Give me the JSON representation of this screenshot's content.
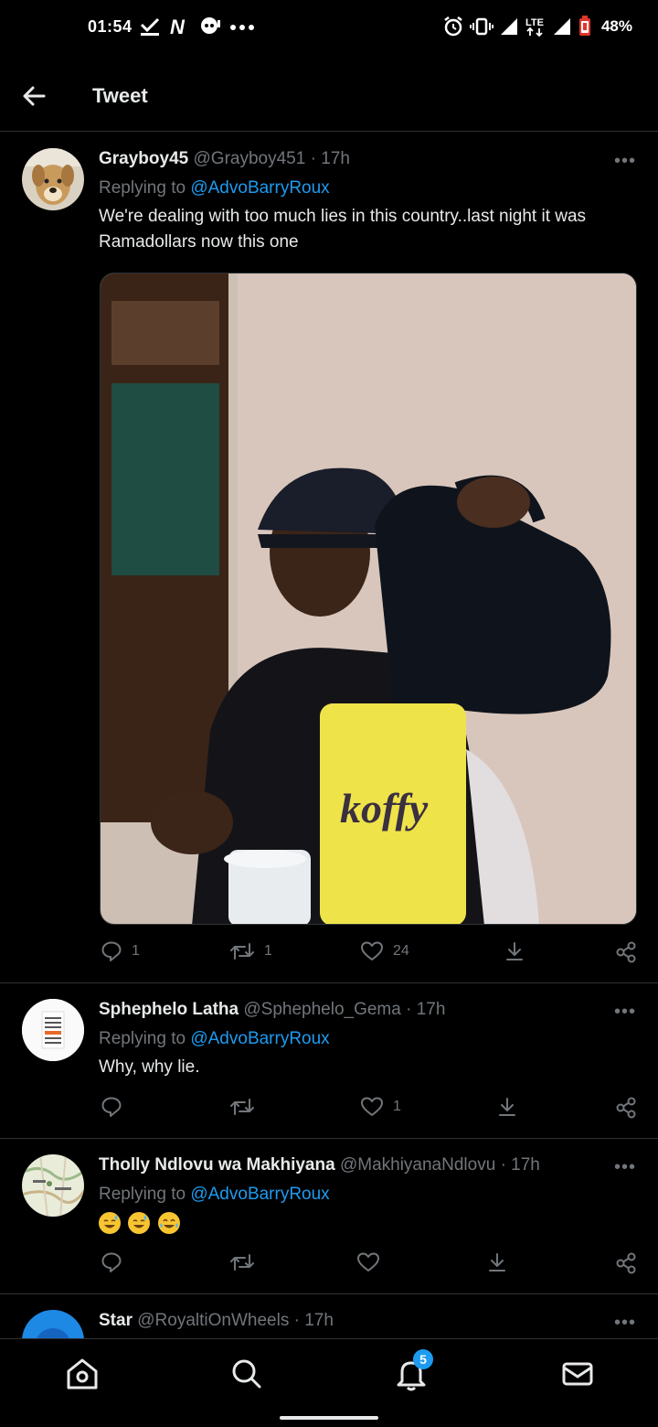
{
  "status_bar": {
    "time": "01:54",
    "battery": "48%",
    "network": "LTE",
    "icons": [
      "check-icon",
      "netflix-icon",
      "messenger-icon",
      "more-dots-icon",
      "alarm-icon",
      "vibrate-icon",
      "signal-icon",
      "battery-icon"
    ]
  },
  "header": {
    "title": "Tweet",
    "back_icon": "arrow-left-icon"
  },
  "tweets": [
    {
      "name": "Grayboy45",
      "handle": "@Grayboy451",
      "time": "· 17h",
      "replying_prefix": "Replying to ",
      "replying_handle": "@AdvoBarryRoux",
      "text": "We're dealing with too much lies in this country..last night it was Ramadollars now this one",
      "media_alt": "koffy",
      "replies": "1",
      "retweets": "1",
      "likes": "24"
    },
    {
      "name": "Sphephelo Latha",
      "handle": "@Sphephelo_Gema",
      "time": "· 17h",
      "replying_prefix": "Replying to ",
      "replying_handle": "@AdvoBarryRoux",
      "text": "Why, why lie.",
      "replies": "",
      "retweets": "",
      "likes": "1"
    },
    {
      "name": "Tholly Ndlovu wa Makhiyana",
      "handle": "@MakhiyanaNdlovu",
      "time": "· 17h",
      "replying_prefix": "Replying to ",
      "replying_handle": "@AdvoBarryRoux",
      "emojis": [
        "grinning-sweat-emoji",
        "grinning-sweat-emoji",
        "tears-of-joy-emoji"
      ],
      "replies": "",
      "retweets": "",
      "likes": ""
    },
    {
      "name": "Star",
      "handle": "@RoyaltiOnWheels",
      "time": "· 17h"
    }
  ],
  "more_label": "•••",
  "bottom_nav": {
    "items": [
      "home-icon",
      "search-icon",
      "notifications-icon",
      "messages-icon"
    ],
    "notification_count": "5"
  },
  "colors": {
    "accent": "#1d9bf0",
    "muted": "#71767b",
    "text": "#e7e9ea",
    "background": "#000000"
  }
}
